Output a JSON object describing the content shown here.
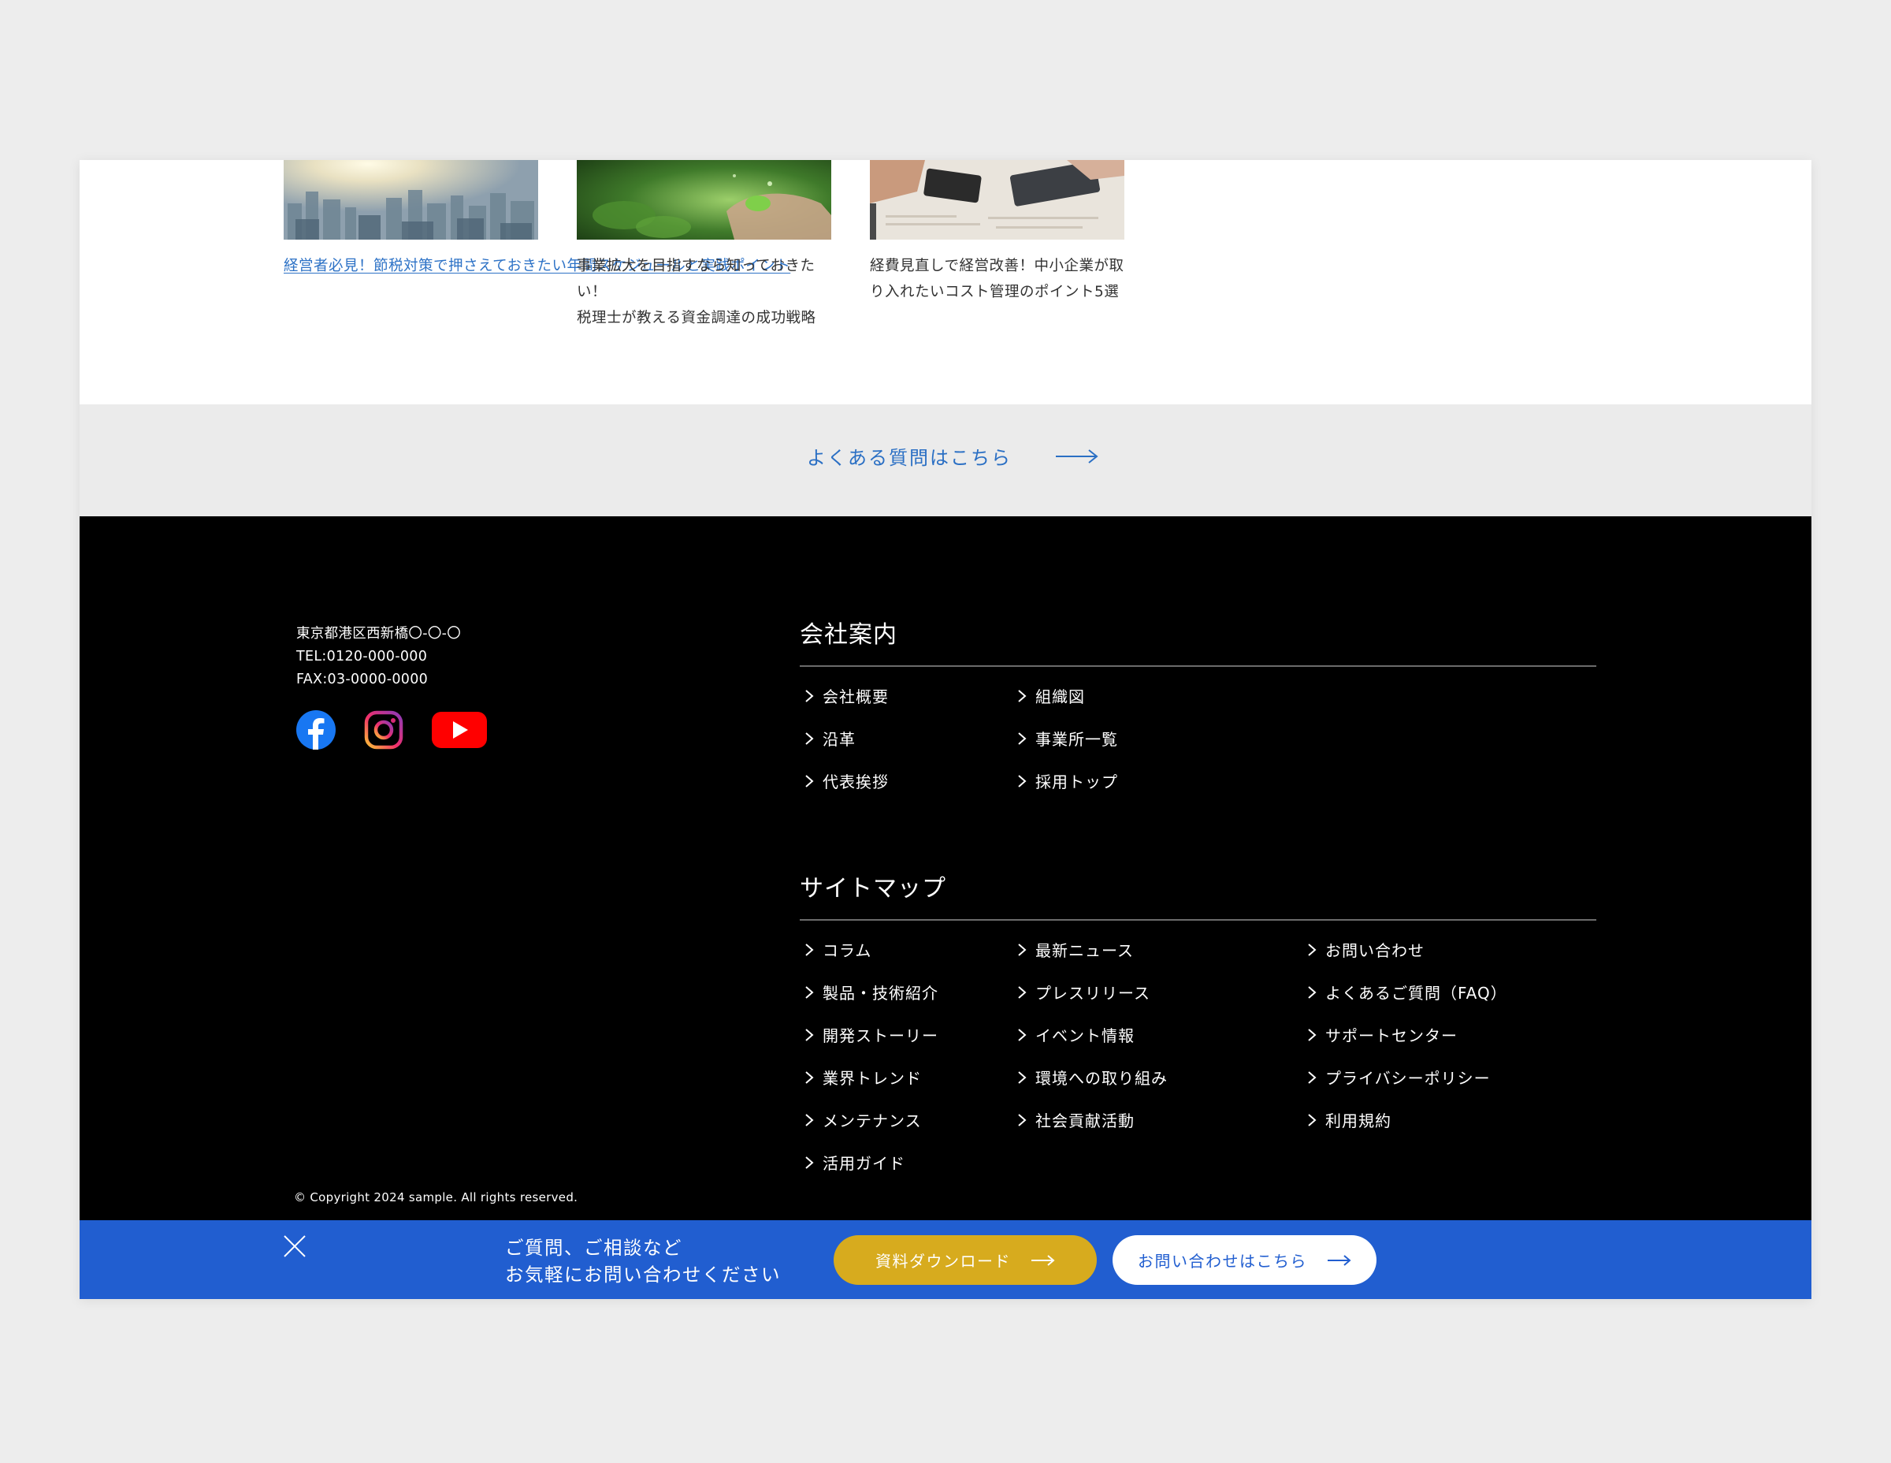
{
  "articles": [
    {
      "title": "経営者必見！節税対策で押さえておきたい年間スケジュールと実践ポイント",
      "line1": "経営者必見！節税対策で押さえておき",
      "line2": "たい年間スケジュールと実践ポイント",
      "thumb": "city-skyline-photo"
    },
    {
      "title": "事業拡大を目指すなら知っておきたい！税理士が教える資金調達の成功戦略",
      "line1": "事業拡大を目指すなら知っておきたい！",
      "line2": "税理士が教える資金調達の成功戦略",
      "thumb": "plant-in-hands-photo"
    },
    {
      "title": "経費見直しで経営改善！中小企業が取り入れたいコスト管理のポイント5選",
      "line1": "経費見直しで経営改善！中小企業が取",
      "line2": "り入れたいコスト管理のポイント5選",
      "thumb": "calculator-desk-photo"
    }
  ],
  "faq": {
    "label": "よくある質問はこちら"
  },
  "footer": {
    "address": "東京都港区西新橋〇-〇-〇",
    "tel": "TEL:0120-000-000",
    "fax": "FAX:03-0000-0000",
    "social": [
      "facebook-icon",
      "instagram-icon",
      "youtube-icon"
    ],
    "company_section": {
      "heading": "会社案内",
      "links": [
        "会社概要",
        "沿革",
        "代表挨拶",
        "組織図",
        "事業所一覧",
        "採用トップ"
      ]
    },
    "sitemap_section": {
      "heading": "サイトマップ",
      "links": [
        "コラム",
        "製品・技術紹介",
        "開発ストーリー",
        "業界トレンド",
        "メンテナンス",
        "活用ガイド",
        "最新ニュース",
        "プレスリリース",
        "イベント情報",
        "環境への取り組み",
        "社会貢献活動",
        "お問い合わせ",
        "よくあるご質問（FAQ）",
        "サポートセンター",
        "プライバシーポリシー",
        "利用規約"
      ]
    },
    "copyright": "© Copyright 2024 sample. All rights reserved."
  },
  "cta_bar": {
    "message_line1": "ご質問、ご相談など",
    "message_line2": "お気軽にお問い合わせください",
    "download_label": "資料ダウンロード",
    "contact_label": "お問い合わせはこちら"
  },
  "colors": {
    "accent_blue": "#215ed0",
    "link_blue": "#2d72c6",
    "gold": "#d7ab1e"
  }
}
